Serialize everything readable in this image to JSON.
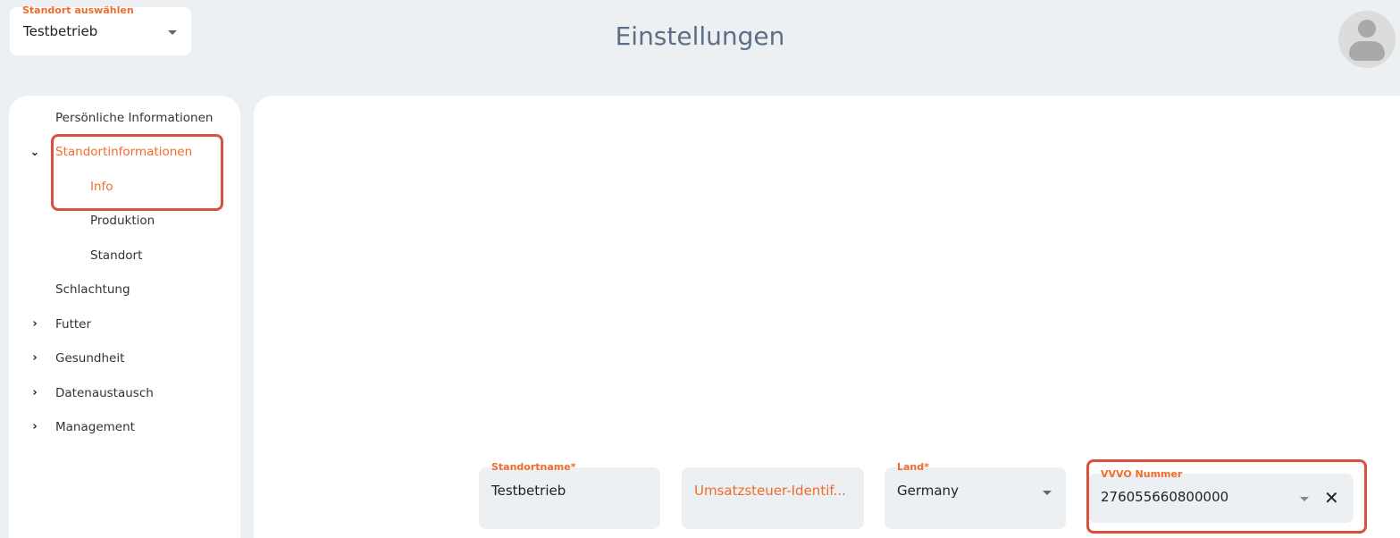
{
  "header": {
    "location_label": "Standort auswählen",
    "location_value": "Testbetrieb",
    "title": "Einstellungen"
  },
  "sidebar": {
    "items": [
      {
        "label": "Persönliche Informationen"
      },
      {
        "label": "Standortinformationen",
        "expanded": true,
        "active": true
      },
      {
        "label": "Info",
        "active": true
      },
      {
        "label": "Produktion"
      },
      {
        "label": "Standort"
      },
      {
        "label": "Schlachtung"
      },
      {
        "label": "Futter",
        "collapsed": true
      },
      {
        "label": "Gesundheit",
        "collapsed": true
      },
      {
        "label": "Datenaustausch",
        "collapsed": true
      },
      {
        "label": "Management",
        "collapsed": true
      }
    ]
  },
  "form": {
    "standortname": {
      "label": "Standortname*",
      "value": "Testbetrieb"
    },
    "ust_id": {
      "placeholder": "Umsatzsteuer-Identif..."
    },
    "land": {
      "label": "Land*",
      "value": "Germany"
    },
    "vvvo": {
      "label": "VVVO Nummer",
      "value": "276055660800000"
    }
  },
  "icons": {
    "expand": "chevron-down",
    "collapse": "chevron-right",
    "clear": "close",
    "dropdown": "caret-down"
  },
  "colors": {
    "accent": "#f26b2c",
    "highlight": "#d9503f",
    "title": "#5b7087",
    "background": "#edf0f3"
  }
}
